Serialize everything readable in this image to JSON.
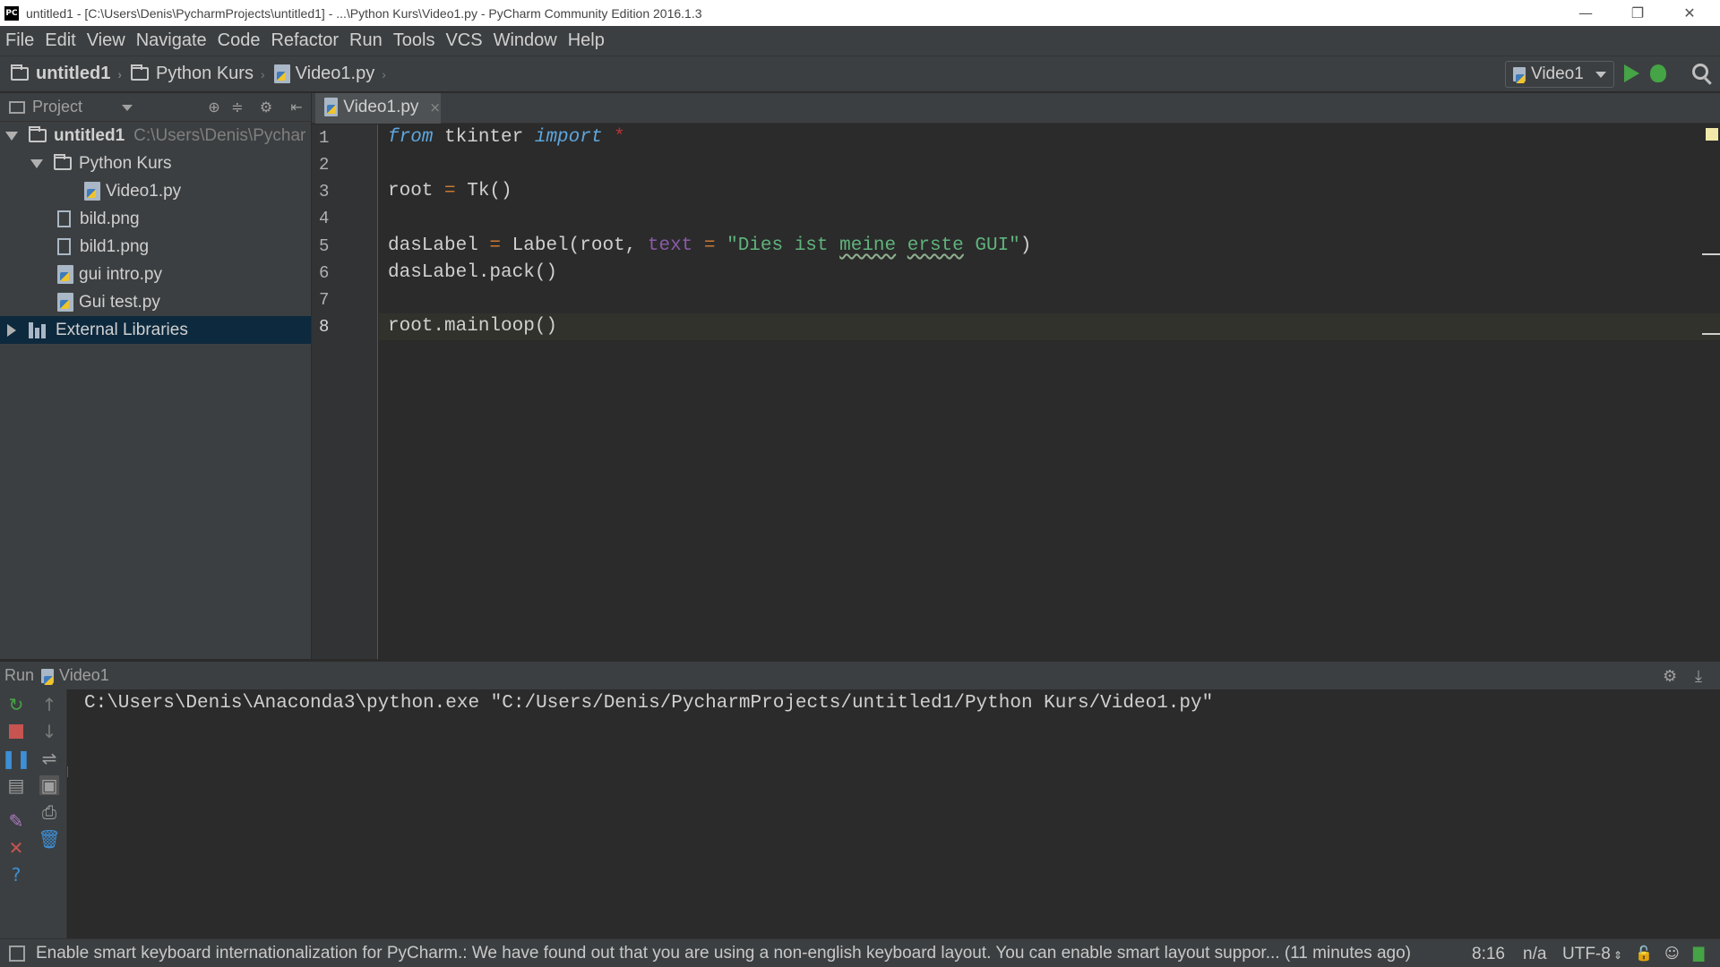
{
  "window": {
    "title": "untitled1 - [C:\\Users\\Denis\\PycharmProjects\\untitled1] - ...\\Python Kurs\\Video1.py - PyCharm Community Edition 2016.1.3",
    "app_icon_text": "PC",
    "minimize": "—",
    "restore": "❐",
    "close": "✕"
  },
  "menu": [
    "File",
    "Edit",
    "View",
    "Navigate",
    "Code",
    "Refactor",
    "Run",
    "Tools",
    "VCS",
    "Window",
    "Help"
  ],
  "breadcrumb": [
    "untitled1",
    "Python Kurs",
    "Video1.py"
  ],
  "run_config": {
    "label": "Video1"
  },
  "project_panel": {
    "title": "Project",
    "tree": [
      {
        "label": "untitled1",
        "path": "C:\\Users\\Denis\\Pychar"
      },
      {
        "label": "Python Kurs"
      },
      {
        "label": "Video1.py"
      },
      {
        "label": "bild.png"
      },
      {
        "label": "bild1.png"
      },
      {
        "label": "gui intro.py"
      },
      {
        "label": "Gui test.py"
      },
      {
        "label": "External Libraries"
      }
    ]
  },
  "editor": {
    "tab_label": "Video1.py",
    "tab_close": "×",
    "line_numbers": [
      "1",
      "2",
      "3",
      "4",
      "5",
      "6",
      "7",
      "8"
    ],
    "code": {
      "l1_from": "from",
      "l1_mod": " tkinter ",
      "l1_import": "import",
      "l1_star": " *",
      "l3_a": "root ",
      "l3_eq": "=",
      "l3_b": " Tk()",
      "l5_a": "dasLabel ",
      "l5_eq": "=",
      "l5_b": " Label(root, ",
      "l5_param": "text",
      "l5_eq2": " = ",
      "l5_str1": "\"Dies ist ",
      "l5_meine": "meine",
      "l5_sp": " ",
      "l5_erste": "erste",
      "l5_str2": " GUI\"",
      "l5_end": ")",
      "l6": "dasLabel.pack()",
      "l8": "root.mainloop()"
    }
  },
  "run_panel": {
    "label": "Run",
    "config": "Video1",
    "output": "C:\\Users\\Denis\\Anaconda3\\python.exe \"C:/Users/Denis/PycharmProjects/untitled1/Python Kurs/Video1.py\""
  },
  "status_bar": {
    "message": "Enable smart keyboard internationalization for PyCharm.: We have found out that you are using a non-english keyboard layout. You can enable smart layout suppor... (11 minutes ago)",
    "position": "8:16",
    "line_sep": "n/a",
    "encoding": "UTF-8"
  }
}
